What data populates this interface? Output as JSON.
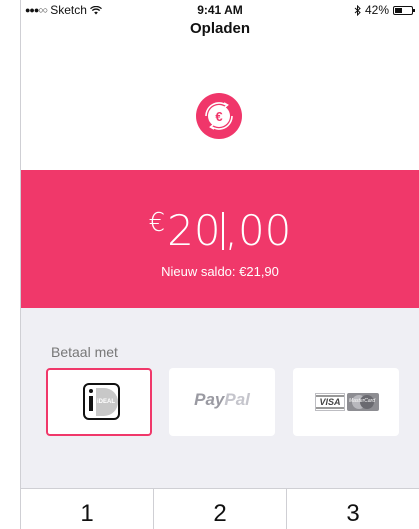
{
  "status_bar": {
    "carrier": "Sketch",
    "time": "9:41 AM",
    "battery_level": "42%",
    "battery_fraction": 0.42
  },
  "nav": {
    "title": "Opladen"
  },
  "amount": {
    "currency": "€",
    "integer_part": "20",
    "decimal_part": ",00",
    "new_balance": "Nieuw saldo: €21,90"
  },
  "payment": {
    "label": "Betaal met",
    "methods": [
      {
        "name": "iDEAL",
        "selected": true
      },
      {
        "name": "PayPal",
        "selected": false
      },
      {
        "name": "VISA / MasterCard",
        "selected": false
      }
    ],
    "ideal_text": "iDEAL",
    "paypal_pay": "Pay",
    "paypal_pal": "Pal",
    "visa_text": "VISA",
    "mc_text": "MasterCard"
  },
  "keypad": {
    "keys": [
      "1",
      "2",
      "3"
    ]
  },
  "colors": {
    "accent": "#f0386a",
    "background_gray": "#efeff4"
  },
  "icons": {
    "coin": "euro-coin-icon",
    "wifi": "wifi-icon",
    "bluetooth": "bluetooth-icon",
    "battery": "battery-icon",
    "signal": "signal-icon"
  }
}
